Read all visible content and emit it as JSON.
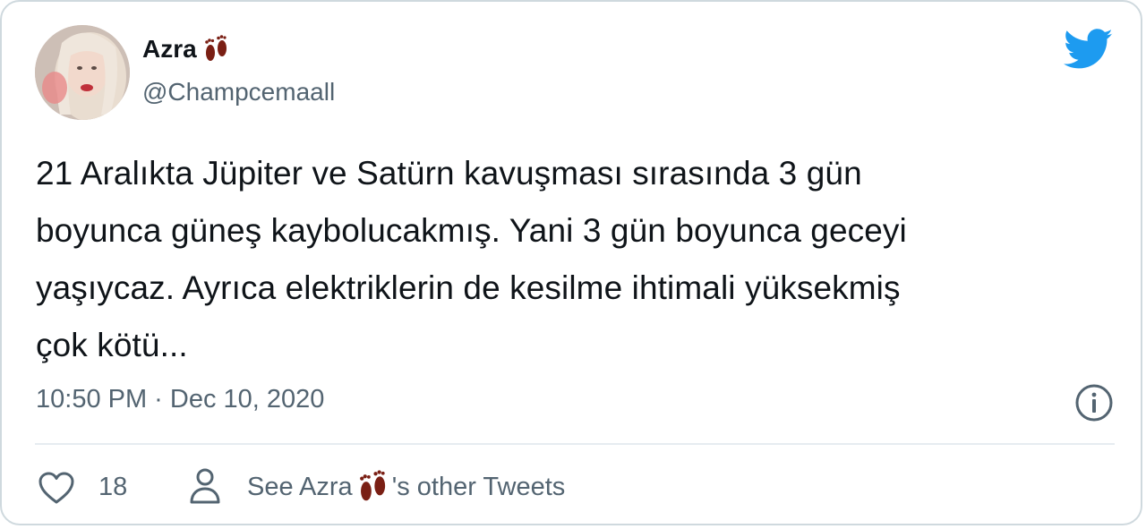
{
  "author": {
    "display_name": "Azra",
    "name_emoji": "footprints-emoji",
    "handle": "@Champcemaall"
  },
  "tweet": {
    "lines": [
      "21 Aralıkta Jüpiter ve Satürn kavuşması sırasında 3 gün",
      "boyunca güneş kaybolucakmış. Yani 3 gün boyunca geceyi",
      "yaşıycaz. Ayrıca elektriklerin de kesilme ihtimali yüksekmiş",
      "çok kötü..."
    ],
    "timestamp": "10:50 PM · Dec 10, 2020"
  },
  "actions": {
    "like_count": "18",
    "see_prefix": "See Azra",
    "see_suffix": "'s other Tweets"
  },
  "icons": {
    "brand": "twitter-bird-icon",
    "info": "info-icon",
    "like": "heart-icon",
    "profile": "person-icon"
  },
  "colors": {
    "twitter_blue": "#1d9bf0",
    "text": "#0f1419",
    "secondary": "#536471",
    "border": "#cfd9de"
  }
}
